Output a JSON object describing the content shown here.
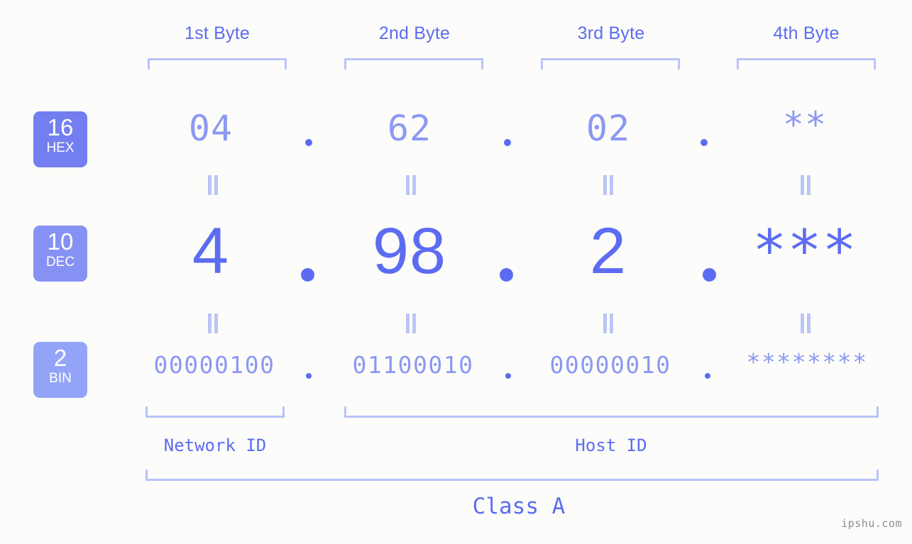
{
  "background_color": "#fcfdfa",
  "accent_color": "#5c6cf2",
  "accent_light_color": "#8c98f3",
  "bracket_color": "#b9c2f7",
  "byte_headers": [
    {
      "label": "1st Byte"
    },
    {
      "label": "2nd Byte"
    },
    {
      "label": "3rd Byte"
    },
    {
      "label": "4th Byte"
    }
  ],
  "bases": [
    {
      "number": "16",
      "name": "HEX",
      "color": "#737ff0"
    },
    {
      "number": "10",
      "name": "DEC",
      "color": "#8691f4"
    },
    {
      "number": "2",
      "name": "BIN",
      "color": "#93a4f8"
    }
  ],
  "rows": {
    "hex": {
      "values": [
        "04",
        "62",
        "02",
        "**"
      ],
      "separator": "."
    },
    "dec": {
      "values": [
        "4",
        "98",
        "2",
        "***"
      ],
      "separator": "."
    },
    "bin": {
      "values": [
        "00000100",
        "01100010",
        "00000010",
        "********"
      ],
      "separator": "."
    }
  },
  "separator_symbol": ".",
  "equality_symbol": "=",
  "sections": [
    {
      "label": "Network ID"
    },
    {
      "label": "Host ID"
    }
  ],
  "class": {
    "label": "Class A"
  },
  "watermark": {
    "text": "ipshu.com"
  }
}
